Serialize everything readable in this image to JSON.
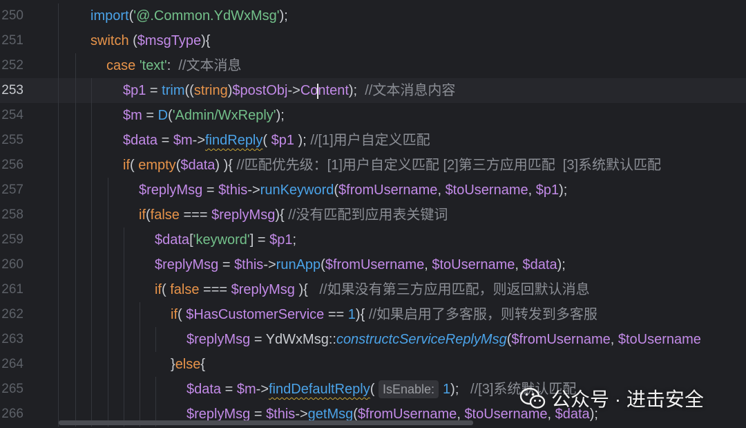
{
  "editor": {
    "current_line": "253",
    "lines": [
      {
        "num": "250",
        "indent": 131,
        "guides": [
          106
        ],
        "segments": [
          [
            "fn",
            "import"
          ],
          [
            "p",
            "("
          ],
          [
            "str",
            "'@.Common.YdWxMsg'"
          ],
          [
            "p",
            ");"
          ]
        ]
      },
      {
        "num": "251",
        "indent": 131,
        "guides": [
          106
        ],
        "segments": [
          [
            "kw",
            "switch"
          ],
          [
            "p",
            " ("
          ],
          [
            "var",
            "$msgType"
          ],
          [
            "p",
            "){"
          ]
        ]
      },
      {
        "num": "252",
        "indent": 154,
        "guides": [
          106,
          131
        ],
        "segments": [
          [
            "kw",
            "case"
          ],
          [
            "p",
            " "
          ],
          [
            "str",
            "'text'"
          ],
          [
            "p",
            ":  "
          ],
          [
            "cm",
            "//文本消息"
          ]
        ]
      },
      {
        "num": "253",
        "indent": 178,
        "guides": [
          106,
          131,
          154
        ],
        "segments": [
          [
            "var",
            "$p1"
          ],
          [
            "p",
            " = "
          ],
          [
            "fn",
            "trim"
          ],
          [
            "p",
            "(("
          ],
          [
            "kw",
            "string"
          ],
          [
            "p",
            ")"
          ],
          [
            "var",
            "$postObj"
          ],
          [
            "p",
            "->"
          ],
          [
            "var",
            "Co"
          ],
          [
            "caret",
            ""
          ],
          [
            "var",
            "ntent"
          ],
          [
            "p",
            ");  "
          ],
          [
            "cm",
            "//文本消息内容"
          ]
        ]
      },
      {
        "num": "254",
        "indent": 178,
        "guides": [
          106,
          131,
          154
        ],
        "segments": [
          [
            "var",
            "$m"
          ],
          [
            "p",
            " = "
          ],
          [
            "fn",
            "D"
          ],
          [
            "p",
            "("
          ],
          [
            "str",
            "'Admin/WxReply'"
          ],
          [
            "p",
            ");"
          ]
        ]
      },
      {
        "num": "255",
        "indent": 178,
        "guides": [
          106,
          131,
          154
        ],
        "segments": [
          [
            "var",
            "$data"
          ],
          [
            "p",
            " = "
          ],
          [
            "var",
            "$m"
          ],
          [
            "p",
            "->"
          ],
          [
            "fnsq",
            "findReply"
          ],
          [
            "p",
            "( "
          ],
          [
            "var",
            "$p1"
          ],
          [
            "p",
            " ); "
          ],
          [
            "cm",
            "//[1]用户自定义匹配"
          ]
        ]
      },
      {
        "num": "256",
        "indent": 178,
        "guides": [
          106,
          131,
          154
        ],
        "segments": [
          [
            "kw",
            "if"
          ],
          [
            "p",
            "( "
          ],
          [
            "kw",
            "empty"
          ],
          [
            "p",
            "("
          ],
          [
            "var",
            "$data"
          ],
          [
            "p",
            ") ){ "
          ],
          [
            "cm",
            "//匹配优先级：[1]用户自定义匹配 [2]第三方应用匹配  [3]系统默认匹配"
          ]
        ]
      },
      {
        "num": "257",
        "indent": 201,
        "guides": [
          106,
          131,
          154,
          178
        ],
        "segments": [
          [
            "var",
            "$replyMsg"
          ],
          [
            "p",
            " = "
          ],
          [
            "var",
            "$this"
          ],
          [
            "p",
            "->"
          ],
          [
            "fn",
            "runKeyword"
          ],
          [
            "p",
            "("
          ],
          [
            "var",
            "$fromUsername"
          ],
          [
            "p",
            ", "
          ],
          [
            "var",
            "$toUsername"
          ],
          [
            "p",
            ", "
          ],
          [
            "var",
            "$p1"
          ],
          [
            "p",
            ");"
          ]
        ]
      },
      {
        "num": "258",
        "indent": 201,
        "guides": [
          106,
          131,
          154,
          178
        ],
        "segments": [
          [
            "kw",
            "if"
          ],
          [
            "p",
            "("
          ],
          [
            "kw",
            "false"
          ],
          [
            "p",
            " === "
          ],
          [
            "var",
            "$replyMsg"
          ],
          [
            "p",
            "){ "
          ],
          [
            "cm",
            "//没有匹配到应用表关键词"
          ]
        ]
      },
      {
        "num": "259",
        "indent": 224,
        "guides": [
          106,
          131,
          154,
          178,
          201
        ],
        "segments": [
          [
            "var",
            "$data"
          ],
          [
            "p",
            "["
          ],
          [
            "str",
            "'keyword'"
          ],
          [
            "p",
            "] = "
          ],
          [
            "var",
            "$p1"
          ],
          [
            "p",
            ";"
          ]
        ]
      },
      {
        "num": "260",
        "indent": 224,
        "guides": [
          106,
          131,
          154,
          178,
          201
        ],
        "segments": [
          [
            "var",
            "$replyMsg"
          ],
          [
            "p",
            " = "
          ],
          [
            "var",
            "$this"
          ],
          [
            "p",
            "->"
          ],
          [
            "fn",
            "runApp"
          ],
          [
            "p",
            "("
          ],
          [
            "var",
            "$fromUsername"
          ],
          [
            "p",
            ", "
          ],
          [
            "var",
            "$toUsername"
          ],
          [
            "p",
            ", "
          ],
          [
            "var",
            "$data"
          ],
          [
            "p",
            ");"
          ]
        ]
      },
      {
        "num": "261",
        "indent": 224,
        "guides": [
          106,
          131,
          154,
          178,
          201
        ],
        "segments": [
          [
            "kw",
            "if"
          ],
          [
            "p",
            "( "
          ],
          [
            "kw",
            "false"
          ],
          [
            "p",
            " === "
          ],
          [
            "var",
            "$replyMsg"
          ],
          [
            "p",
            " ){   "
          ],
          [
            "cm",
            "//如果没有第三方应用匹配，则返回默认消息"
          ]
        ]
      },
      {
        "num": "262",
        "indent": 247,
        "guides": [
          106,
          131,
          154,
          178,
          201,
          224
        ],
        "segments": [
          [
            "kw",
            "if"
          ],
          [
            "p",
            "( "
          ],
          [
            "var",
            "$HasCustomerService"
          ],
          [
            "p",
            " == "
          ],
          [
            "num",
            "1"
          ],
          [
            "p",
            "){ "
          ],
          [
            "cm",
            "//如果启用了多客服，则转发到多客服"
          ]
        ]
      },
      {
        "num": "263",
        "indent": 270,
        "guides": [
          106,
          131,
          154,
          178,
          201,
          224,
          247
        ],
        "segments": [
          [
            "var",
            "$replyMsg"
          ],
          [
            "p",
            " = YdWxMsg::"
          ],
          [
            "fnit",
            "constructcServiceReplyMsg"
          ],
          [
            "p",
            "("
          ],
          [
            "var",
            "$fromUsername"
          ],
          [
            "p",
            ", "
          ],
          [
            "var",
            "$toUsername"
          ]
        ]
      },
      {
        "num": "264",
        "indent": 247,
        "guides": [
          106,
          131,
          154,
          178,
          201,
          224
        ],
        "segments": [
          [
            "p",
            "}"
          ],
          [
            "kw",
            "else"
          ],
          [
            "p",
            "{"
          ]
        ]
      },
      {
        "num": "265",
        "indent": 270,
        "guides": [
          106,
          131,
          154,
          178,
          201,
          224,
          247
        ],
        "segments": [
          [
            "var",
            "$data"
          ],
          [
            "p",
            " = "
          ],
          [
            "var",
            "$m"
          ],
          [
            "p",
            "->"
          ],
          [
            "fnsq",
            "findDefaultReply"
          ],
          [
            "p",
            "( "
          ],
          [
            "hint",
            "IsEnable:"
          ],
          [
            "num",
            "1"
          ],
          [
            "p",
            ");   "
          ],
          [
            "cm",
            "//[3]系统默认匹配"
          ]
        ]
      },
      {
        "num": "266",
        "indent": 270,
        "guides": [
          106,
          131,
          154,
          178,
          201,
          224,
          247
        ],
        "segments": [
          [
            "var",
            "$replyMsg"
          ],
          [
            "p",
            " = "
          ],
          [
            "var",
            "$this"
          ],
          [
            "p",
            "->"
          ],
          [
            "fn",
            "getMsg"
          ],
          [
            "p",
            "("
          ],
          [
            "var",
            "$fromUsername"
          ],
          [
            "p",
            ", "
          ],
          [
            "var",
            "$toUsername"
          ],
          [
            "p",
            ", "
          ],
          [
            "var",
            "$data"
          ],
          [
            "p",
            ");"
          ]
        ]
      }
    ]
  },
  "watermark": {
    "icon": "wechat-icon",
    "text": "公众号 · 进击安全"
  },
  "colors": {
    "background": "#1f2024",
    "keyword": "#e8944a",
    "variable": "#c38be8",
    "string": "#73c08a",
    "function": "#4ba3e8",
    "comment": "#8b8e95"
  }
}
